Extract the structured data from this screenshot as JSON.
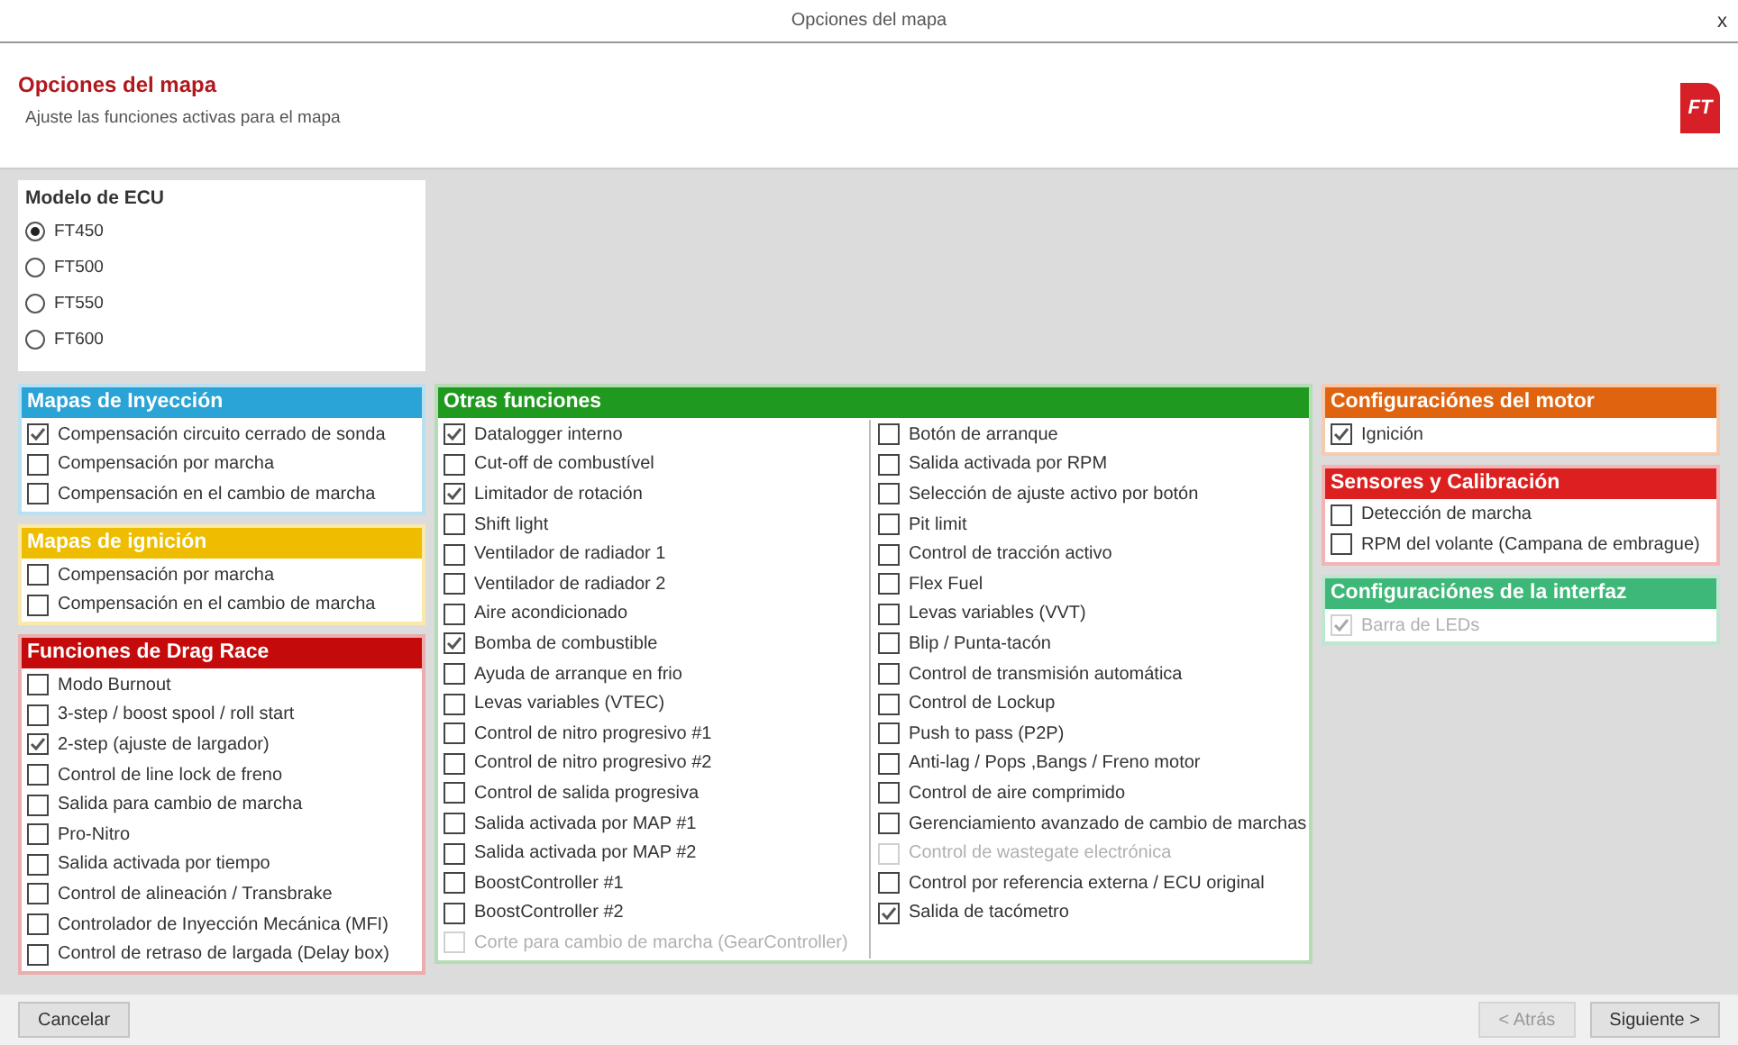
{
  "window": {
    "title": "Opciones del mapa",
    "close": "x"
  },
  "header": {
    "title": "Opciones del mapa",
    "subtitle": "Ajuste las funciones activas para el mapa",
    "logo": "FT"
  },
  "ecu_model": {
    "title": "Modelo de ECU",
    "options": [
      {
        "label": "FT450",
        "selected": true
      },
      {
        "label": "FT500",
        "selected": false
      },
      {
        "label": "FT550",
        "selected": false
      },
      {
        "label": "FT600",
        "selected": false
      }
    ]
  },
  "left_panels": [
    {
      "title": "Mapas de Inyección",
      "color": "#2aa3d6",
      "columns": [
        [
          {
            "label": "Compensación circuito cerrado de sonda",
            "checked": true,
            "disabled": false
          },
          {
            "label": "Compensación por marcha",
            "checked": false,
            "disabled": false
          },
          {
            "label": "Compensación en el cambio de marcha",
            "checked": false,
            "disabled": false
          }
        ]
      ]
    },
    {
      "title": "Mapas de ignición",
      "color": "#eebd00",
      "columns": [
        [
          {
            "label": "Compensación por marcha",
            "checked": false,
            "disabled": false
          },
          {
            "label": "Compensación en el cambio de marcha",
            "checked": false,
            "disabled": false
          }
        ]
      ]
    },
    {
      "title": "Funciones de Drag Race",
      "color": "#c40a0a",
      "columns": [
        [
          {
            "label": "Modo Burnout",
            "checked": false,
            "disabled": false
          },
          {
            "label": "3-step / boost spool / roll start",
            "checked": false,
            "disabled": false
          },
          {
            "label": "2-step (ajuste de largador)",
            "checked": true,
            "disabled": false
          },
          {
            "label": "Control de line lock de freno",
            "checked": false,
            "disabled": false
          },
          {
            "label": "Salida para cambio de marcha",
            "checked": false,
            "disabled": false
          },
          {
            "label": "Pro-Nitro",
            "checked": false,
            "disabled": false
          },
          {
            "label": "Salida activada por tiempo",
            "checked": false,
            "disabled": false
          },
          {
            "label": "Control de alineación / Transbrake",
            "checked": false,
            "disabled": false
          },
          {
            "label": "Controlador de Inyección Mecánica (MFI)",
            "checked": false,
            "disabled": false
          },
          {
            "label": "Control de retraso de largada (Delay box)",
            "checked": false,
            "disabled": false
          }
        ]
      ]
    }
  ],
  "middle_panels": [
    {
      "title": "Otras funciones",
      "color": "#1f9a1f",
      "columns": [
        [
          {
            "label": "Datalogger interno",
            "checked": true,
            "disabled": false
          },
          {
            "label": "Cut-off de combustível",
            "checked": false,
            "disabled": false
          },
          {
            "label": "Limitador de rotación",
            "checked": true,
            "disabled": false
          },
          {
            "label": "Shift light",
            "checked": false,
            "disabled": false
          },
          {
            "label": "Ventilador de radiador 1",
            "checked": false,
            "disabled": false
          },
          {
            "label": "Ventilador de radiador 2",
            "checked": false,
            "disabled": false
          },
          {
            "label": "Aire acondicionado",
            "checked": false,
            "disabled": false
          },
          {
            "label": "Bomba de combustible",
            "checked": true,
            "disabled": false
          },
          {
            "label": "Ayuda de arranque en frio",
            "checked": false,
            "disabled": false
          },
          {
            "label": "Levas variables (VTEC)",
            "checked": false,
            "disabled": false
          },
          {
            "label": "Control de nitro progresivo #1",
            "checked": false,
            "disabled": false
          },
          {
            "label": "Control de nitro progresivo #2",
            "checked": false,
            "disabled": false
          },
          {
            "label": "Control de salida progresiva",
            "checked": false,
            "disabled": false
          },
          {
            "label": "Salida activada por MAP #1",
            "checked": false,
            "disabled": false
          },
          {
            "label": "Salida activada por MAP #2",
            "checked": false,
            "disabled": false
          },
          {
            "label": "BoostController #1",
            "checked": false,
            "disabled": false
          },
          {
            "label": "BoostController #2",
            "checked": false,
            "disabled": false
          },
          {
            "label": "Corte para cambio de marcha (GearController)",
            "checked": false,
            "disabled": true
          }
        ],
        [
          {
            "label": "Botón de arranque",
            "checked": false,
            "disabled": false
          },
          {
            "label": "Salida activada por RPM",
            "checked": false,
            "disabled": false
          },
          {
            "label": "Selección de ajuste activo por botón",
            "checked": false,
            "disabled": false
          },
          {
            "label": "Pit limit",
            "checked": false,
            "disabled": false
          },
          {
            "label": "Control de tracción activo",
            "checked": false,
            "disabled": false
          },
          {
            "label": "Flex Fuel",
            "checked": false,
            "disabled": false
          },
          {
            "label": "Levas variables (VVT)",
            "checked": false,
            "disabled": false
          },
          {
            "label": "Blip / Punta-tacón",
            "checked": false,
            "disabled": false
          },
          {
            "label": "Control de transmisión automática",
            "checked": false,
            "disabled": false
          },
          {
            "label": "Control de Lockup",
            "checked": false,
            "disabled": false
          },
          {
            "label": "Push to pass (P2P)",
            "checked": false,
            "disabled": false
          },
          {
            "label": "Anti-lag / Pops ,Bangs / Freno motor",
            "checked": false,
            "disabled": false
          },
          {
            "label": "Control de aire comprimido",
            "checked": false,
            "disabled": false
          },
          {
            "label": "Gerenciamiento avanzado de cambio de marchas",
            "checked": false,
            "disabled": false
          },
          {
            "label": "Control de wastegate electrónica",
            "checked": false,
            "disabled": true
          },
          {
            "label": "Control por referencia externa / ECU original",
            "checked": false,
            "disabled": false
          },
          {
            "label": "Salida de tacómetro",
            "checked": true,
            "disabled": false
          }
        ]
      ]
    }
  ],
  "right_panels": [
    {
      "title": "Configuraciónes del motor",
      "color": "#e0640f",
      "columns": [
        [
          {
            "label": "Ignición",
            "checked": true,
            "disabled": false
          }
        ]
      ]
    },
    {
      "title": "Sensores y Calibración",
      "color": "#dc1f1f",
      "columns": [
        [
          {
            "label": "Detección de marcha",
            "checked": false,
            "disabled": false
          },
          {
            "label": "RPM del volante (Campana de embrague)",
            "checked": false,
            "disabled": false
          }
        ]
      ]
    },
    {
      "title": "Configuraciónes de la interfaz",
      "color": "#3db878",
      "columns": [
        [
          {
            "label": "Barra de LEDs",
            "checked": true,
            "disabled": true
          }
        ]
      ]
    }
  ],
  "footer": {
    "cancel": {
      "label": "Cancelar",
      "disabled": false
    },
    "back": {
      "label": "< Atrás",
      "disabled": true
    },
    "next": {
      "label": "Siguiente >",
      "disabled": false
    }
  }
}
